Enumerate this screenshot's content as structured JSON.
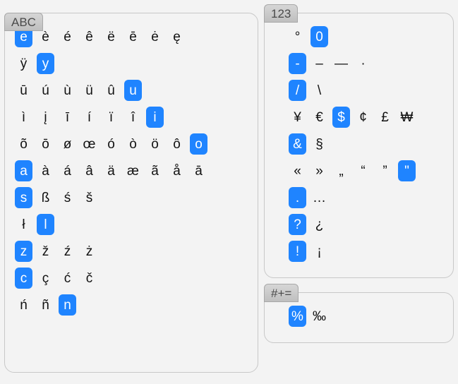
{
  "abc": {
    "tab": "ABC",
    "rows": [
      [
        {
          "c": "e",
          "sel": true
        },
        {
          "c": "è"
        },
        {
          "c": "é"
        },
        {
          "c": "ê"
        },
        {
          "c": "ë"
        },
        {
          "c": "ē"
        },
        {
          "c": "ė"
        },
        {
          "c": "ę"
        }
      ],
      [
        {
          "c": "ÿ"
        },
        {
          "c": "y",
          "sel": true
        }
      ],
      [
        {
          "c": "ū"
        },
        {
          "c": "ú"
        },
        {
          "c": "ù"
        },
        {
          "c": "ü"
        },
        {
          "c": "û"
        },
        {
          "c": "u",
          "sel": true
        }
      ],
      [
        {
          "c": "ì"
        },
        {
          "c": "į"
        },
        {
          "c": "ī"
        },
        {
          "c": "í"
        },
        {
          "c": "ï"
        },
        {
          "c": "î"
        },
        {
          "c": "i",
          "sel": true
        }
      ],
      [
        {
          "c": "õ"
        },
        {
          "c": "ō"
        },
        {
          "c": "ø"
        },
        {
          "c": "œ"
        },
        {
          "c": "ó"
        },
        {
          "c": "ò"
        },
        {
          "c": "ö"
        },
        {
          "c": "ô"
        },
        {
          "c": "o",
          "sel": true
        }
      ],
      [
        {
          "c": "a",
          "sel": true
        },
        {
          "c": "à"
        },
        {
          "c": "á"
        },
        {
          "c": "â"
        },
        {
          "c": "ä"
        },
        {
          "c": "æ"
        },
        {
          "c": "ã"
        },
        {
          "c": "å"
        },
        {
          "c": "ā"
        }
      ],
      [
        {
          "c": "s",
          "sel": true
        },
        {
          "c": "ß"
        },
        {
          "c": "ś"
        },
        {
          "c": "š"
        }
      ],
      [
        {
          "c": "ł"
        },
        {
          "c": "l",
          "sel": true
        }
      ],
      [
        {
          "c": "z",
          "sel": true
        },
        {
          "c": "ž"
        },
        {
          "c": "ź"
        },
        {
          "c": "ż"
        }
      ],
      [
        {
          "c": "c",
          "sel": true
        },
        {
          "c": "ç"
        },
        {
          "c": "ć"
        },
        {
          "c": "č"
        }
      ],
      [
        {
          "c": "ń"
        },
        {
          "c": "ñ"
        },
        {
          "c": "n",
          "sel": true
        }
      ]
    ]
  },
  "num": {
    "tab": "123",
    "rows": [
      [
        {
          "c": "°"
        },
        {
          "c": "0",
          "sel": true
        }
      ],
      [
        {
          "c": "-",
          "sel": true
        },
        {
          "c": "–"
        },
        {
          "c": "—"
        },
        {
          "c": "·"
        }
      ],
      [
        {
          "c": "/",
          "sel": true
        },
        {
          "c": "\\"
        }
      ],
      [
        {
          "c": "¥"
        },
        {
          "c": "€"
        },
        {
          "c": "$",
          "sel": true
        },
        {
          "c": "¢"
        },
        {
          "c": "£"
        },
        {
          "c": "₩"
        }
      ],
      [
        {
          "c": "&",
          "sel": true
        },
        {
          "c": "§"
        }
      ],
      [
        {
          "c": "«"
        },
        {
          "c": "»"
        },
        {
          "c": "„"
        },
        {
          "c": "“"
        },
        {
          "c": "”"
        },
        {
          "c": "\"",
          "sel": true
        }
      ],
      [
        {
          "c": ".",
          "sel": true
        },
        {
          "c": "…"
        }
      ],
      [
        {
          "c": "?",
          "sel": true
        },
        {
          "c": "¿"
        }
      ],
      [
        {
          "c": "!",
          "sel": true
        },
        {
          "c": "¡"
        }
      ]
    ]
  },
  "sym": {
    "tab": "#+=",
    "rows": [
      [
        {
          "c": "%",
          "sel": true
        },
        {
          "c": "‰"
        }
      ]
    ]
  }
}
